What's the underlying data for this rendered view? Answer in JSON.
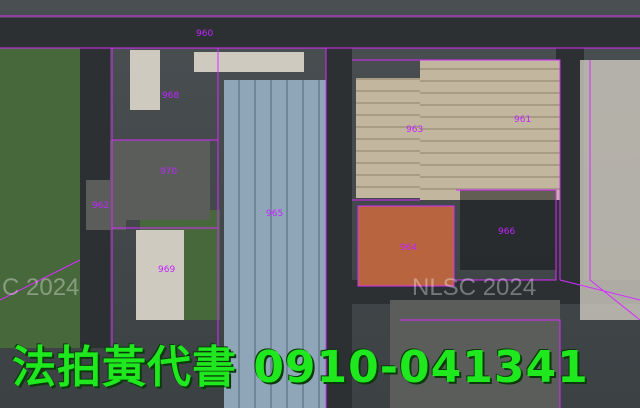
{
  "map": {
    "imagery": "aerial-satellite",
    "parcel_line_color": "#d62cff",
    "label_color": "#c024ff",
    "lot_labels": [
      "960",
      "961",
      "962",
      "963",
      "964",
      "965",
      "966",
      "970",
      "969",
      "968"
    ],
    "watermarks": [
      "C 2024",
      "NLSC 2024"
    ]
  },
  "banner": {
    "text": "法拍黃代書 0910-041341",
    "color": "#1fe81f"
  }
}
